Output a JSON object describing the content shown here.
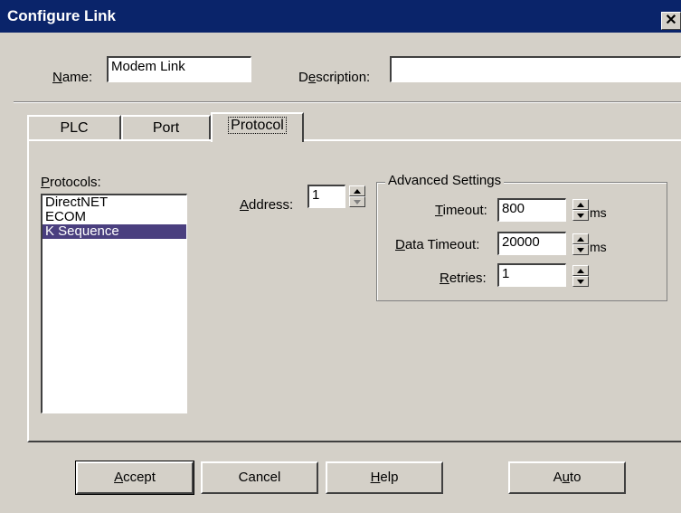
{
  "window": {
    "title": "Configure Link",
    "close_glyph": "✕"
  },
  "top": {
    "name_label_u": "N",
    "name_label_rest": "ame:",
    "name_value": "Modem Link",
    "desc_label_pre": "D",
    "desc_label_u": "e",
    "desc_label_rest": "scription:",
    "desc_value": ""
  },
  "tabs": [
    "PLC",
    "Port",
    "Protocol"
  ],
  "protocols": {
    "label_u": "P",
    "label_rest": "rotocols:",
    "items": [
      "DirectNET",
      "ECOM",
      "K Sequence"
    ],
    "selected": "K Sequence"
  },
  "address": {
    "label_u": "A",
    "label_rest": "ddress:",
    "value": "1"
  },
  "advanced": {
    "title": "Advanced Settings",
    "timeout": {
      "label_u": "T",
      "label_rest": "imeout:",
      "value": "800",
      "unit": "ms"
    },
    "data_timeout": {
      "label_u": "D",
      "label_rest": "ata Timeout:",
      "value": "20000",
      "unit": "ms"
    },
    "retries": {
      "label_u": "R",
      "label_rest": "etries:",
      "value": "1"
    }
  },
  "buttons": {
    "accept_u": "A",
    "accept_rest": "ccept",
    "cancel": "Cancel",
    "help_u": "H",
    "help_rest": "elp",
    "auto_pre": "A",
    "auto_u": "u",
    "auto_rest": "to"
  },
  "colors": {
    "title_bar": "#0a246a",
    "face": "#d4d0c8",
    "selection": "#4a3f7f"
  }
}
